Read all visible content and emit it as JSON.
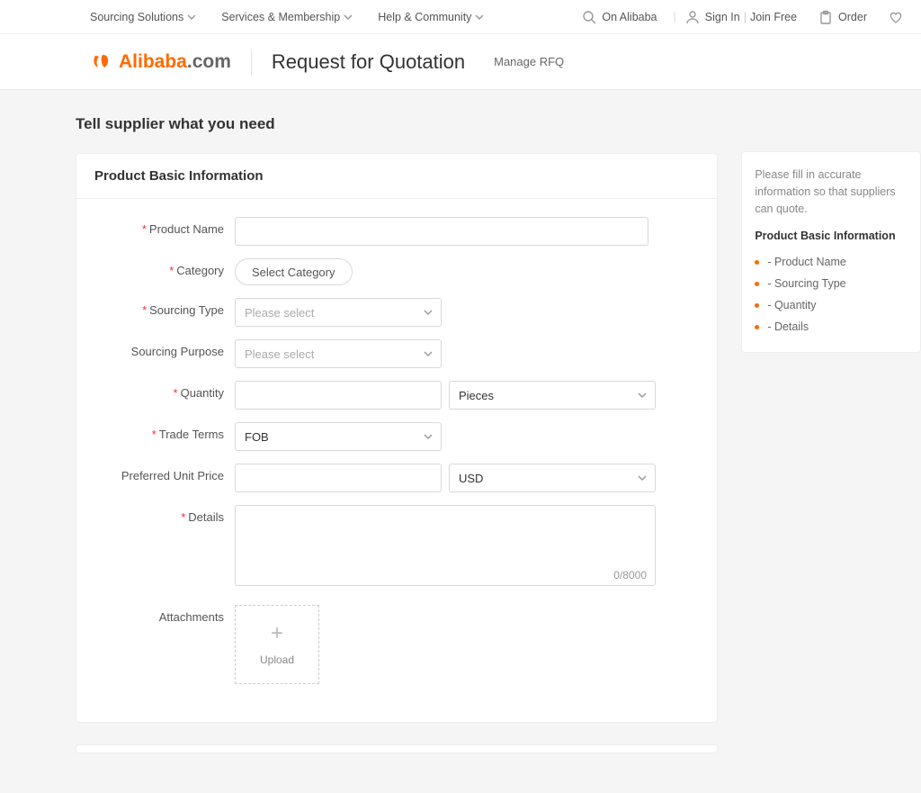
{
  "top_nav": {
    "sourcing": "Sourcing Solutions",
    "services": "Services & Membership",
    "help": "Help & Community",
    "search_toggle": "On Alibaba",
    "sign_in": "Sign In",
    "join": "Join Free",
    "order": "Order"
  },
  "logo": {
    "brand": "Alibaba",
    "suffix": ".com"
  },
  "sub_header": {
    "title": "Request for Quotation",
    "manage": "Manage RFQ"
  },
  "page": {
    "heading": "Tell supplier what you need"
  },
  "card": {
    "title": "Product Basic Information"
  },
  "form": {
    "product_name": {
      "label": "Product Name",
      "value": ""
    },
    "category": {
      "label": "Category",
      "button": "Select Category"
    },
    "sourcing_type": {
      "label": "Sourcing Type",
      "placeholder": "Please select"
    },
    "sourcing_purpose": {
      "label": "Sourcing Purpose",
      "placeholder": "Please select"
    },
    "quantity": {
      "label": "Quantity",
      "value": "",
      "unit": "Pieces"
    },
    "trade_terms": {
      "label": "Trade Terms",
      "value": "FOB"
    },
    "unit_price": {
      "label": "Preferred Unit Price",
      "value": "",
      "currency": "USD"
    },
    "details": {
      "label": "Details",
      "value": "",
      "counter": "0/8000"
    },
    "attachments": {
      "label": "Attachments",
      "upload": "Upload"
    }
  },
  "side": {
    "desc": "Please fill in accurate information so that suppliers can quote.",
    "head": "Product Basic Information",
    "items": [
      "- Product Name",
      "- Sourcing Type",
      "- Quantity",
      "- Details"
    ]
  },
  "colors": {
    "accent": "#ff6a00",
    "required": "#f23030"
  }
}
